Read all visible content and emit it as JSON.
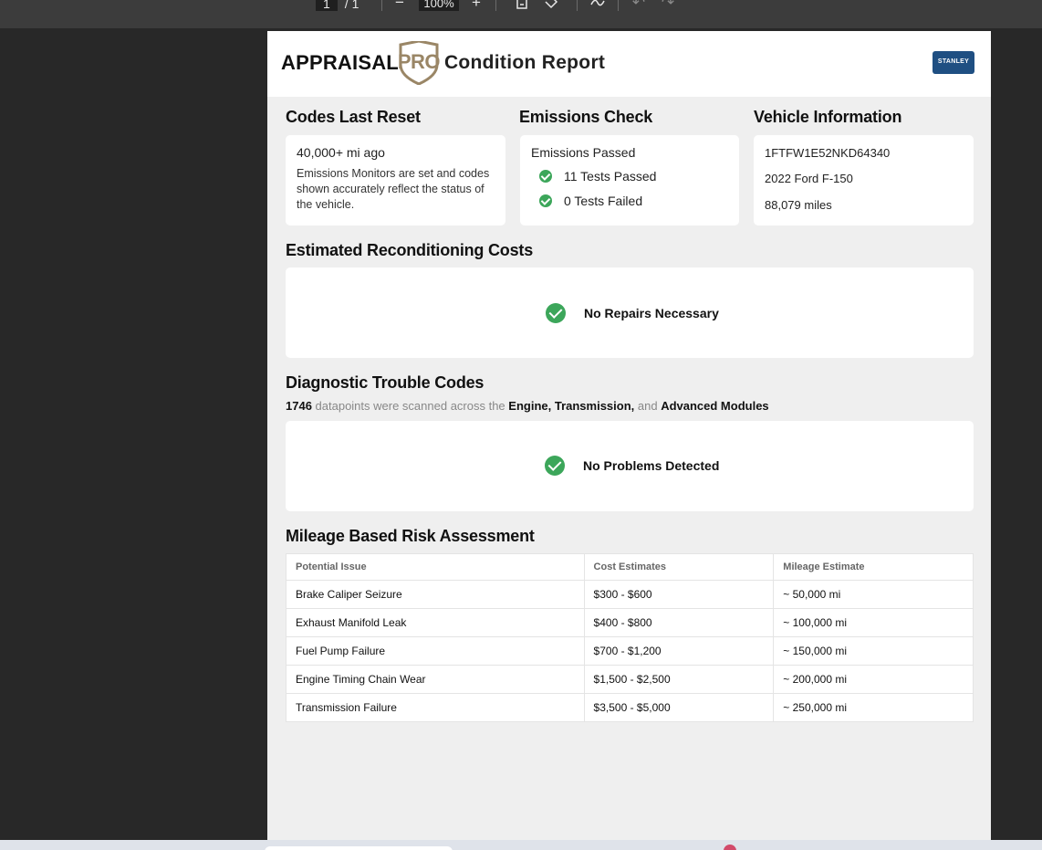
{
  "viewer": {
    "current_page": "1",
    "total_pages": "/ 1",
    "zoom": "100%",
    "zoom_out": "−",
    "zoom_in": "+"
  },
  "header": {
    "brand_left": "APPRAISAL",
    "brand_right": "PRO",
    "title": "Condition Report",
    "dealer": "STANLEY"
  },
  "codes_last_reset": {
    "title": "Codes Last Reset",
    "value": "40,000+ mi ago",
    "description": "Emissions Monitors are set and codes shown accurately reflect the status of the vehicle."
  },
  "emissions": {
    "title": "Emissions Check",
    "status": "Emissions Passed",
    "passed": "11 Tests Passed",
    "failed": "0 Tests Failed"
  },
  "vehicle": {
    "title": "Vehicle Information",
    "vin": "1FTFW1E52NKD64340",
    "model": "2022 Ford F-150",
    "mileage": "88,079 miles"
  },
  "reconditioning": {
    "title": "Estimated Reconditioning Costs",
    "message": "No Repairs Necessary"
  },
  "dtc": {
    "title": "Diagnostic Trouble Codes",
    "count": "1746",
    "text1": " datapoints were scanned across the ",
    "modules1": "Engine, Transmission,",
    "text2": " and ",
    "modules2": "Advanced Modules",
    "message": "No Problems Detected"
  },
  "risk": {
    "title": "Mileage Based Risk Assessment",
    "headers": [
      "Potential Issue",
      "Cost Estimates",
      "Mileage Estimate"
    ],
    "rows": [
      [
        "Brake Caliper Seizure",
        "$300 - $600",
        "~ 50,000 mi"
      ],
      [
        "Exhaust Manifold Leak",
        "$400 - $800",
        "~ 100,000 mi"
      ],
      [
        "Fuel Pump Failure",
        "$700 - $1,200",
        "~ 150,000 mi"
      ],
      [
        "Engine Timing Chain Wear",
        "$1,500 - $2,500",
        "~ 200,000 mi"
      ],
      [
        "Transmission Failure",
        "$3,500 - $5,000",
        "~ 250,000 mi"
      ]
    ]
  },
  "colors": {
    "check_green": "#3ca65a",
    "brand_gold": "#9a8666",
    "dealer_blue": "#1f4f82"
  }
}
